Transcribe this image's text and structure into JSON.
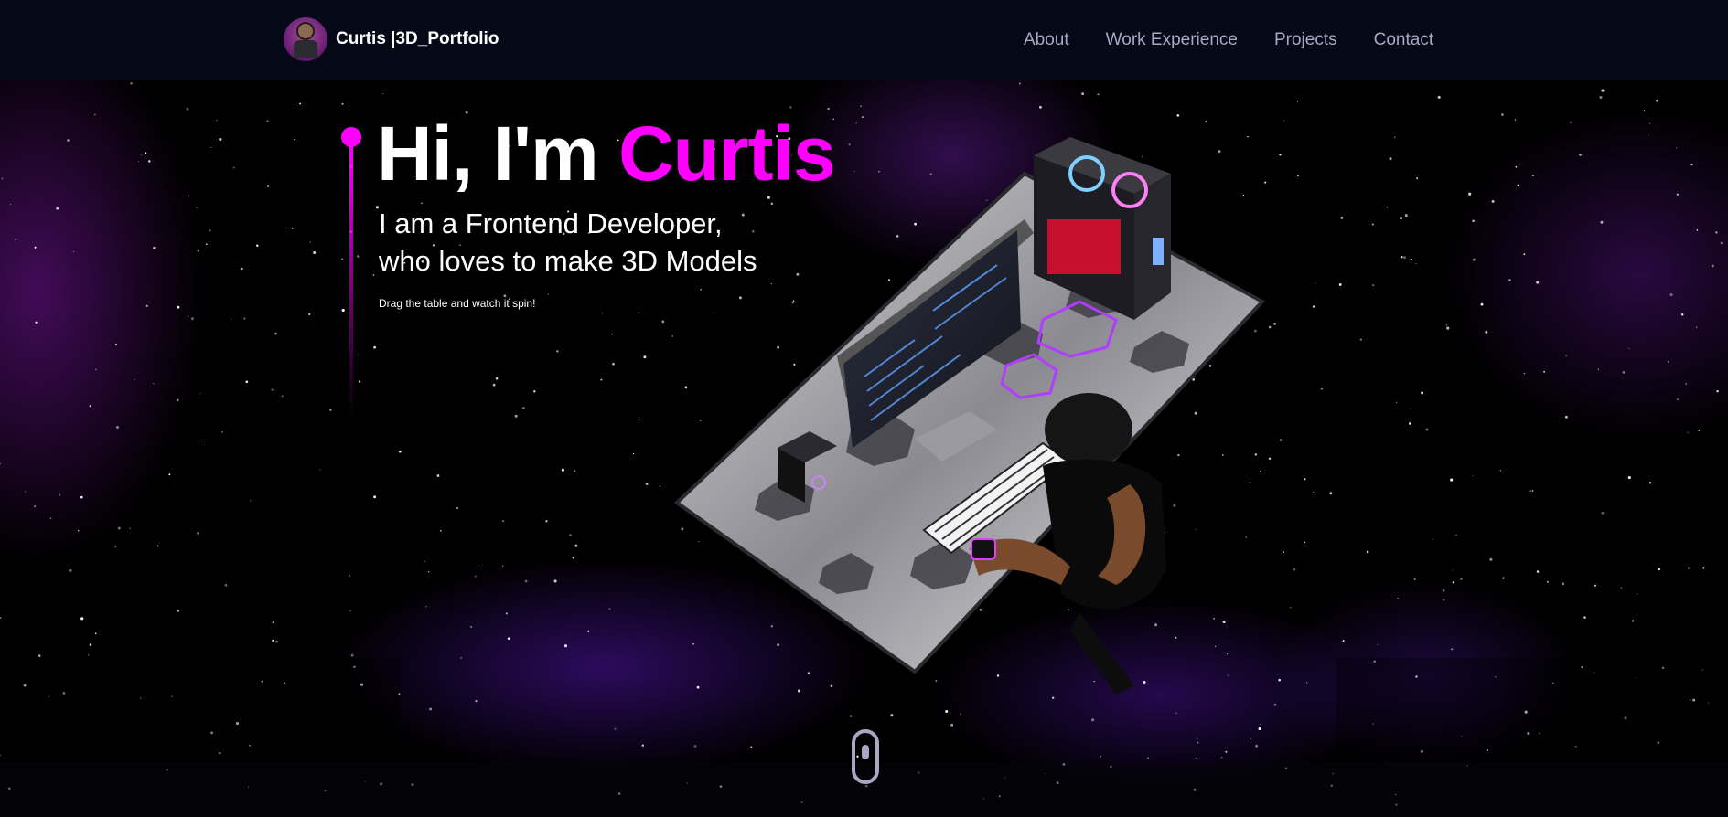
{
  "navbar": {
    "brand": "Curtis |3D_Portfolio",
    "links": [
      "About",
      "Work Experience",
      "Projects",
      "Contact"
    ]
  },
  "hero": {
    "greeting": "Hi, I'm ",
    "name": "Curtis",
    "subtitle_line1": "I am a Frontend Developer,",
    "subtitle_line2": "who loves to make 3D Models",
    "hint": "Drag the table and watch it spin!"
  },
  "colors": {
    "accent": "#ff00ff",
    "navbar_bg": "#050816",
    "nav_link": "#aaa6c3",
    "background": "#000000"
  },
  "icons": {
    "scroll": "mouse-scroll-icon"
  }
}
